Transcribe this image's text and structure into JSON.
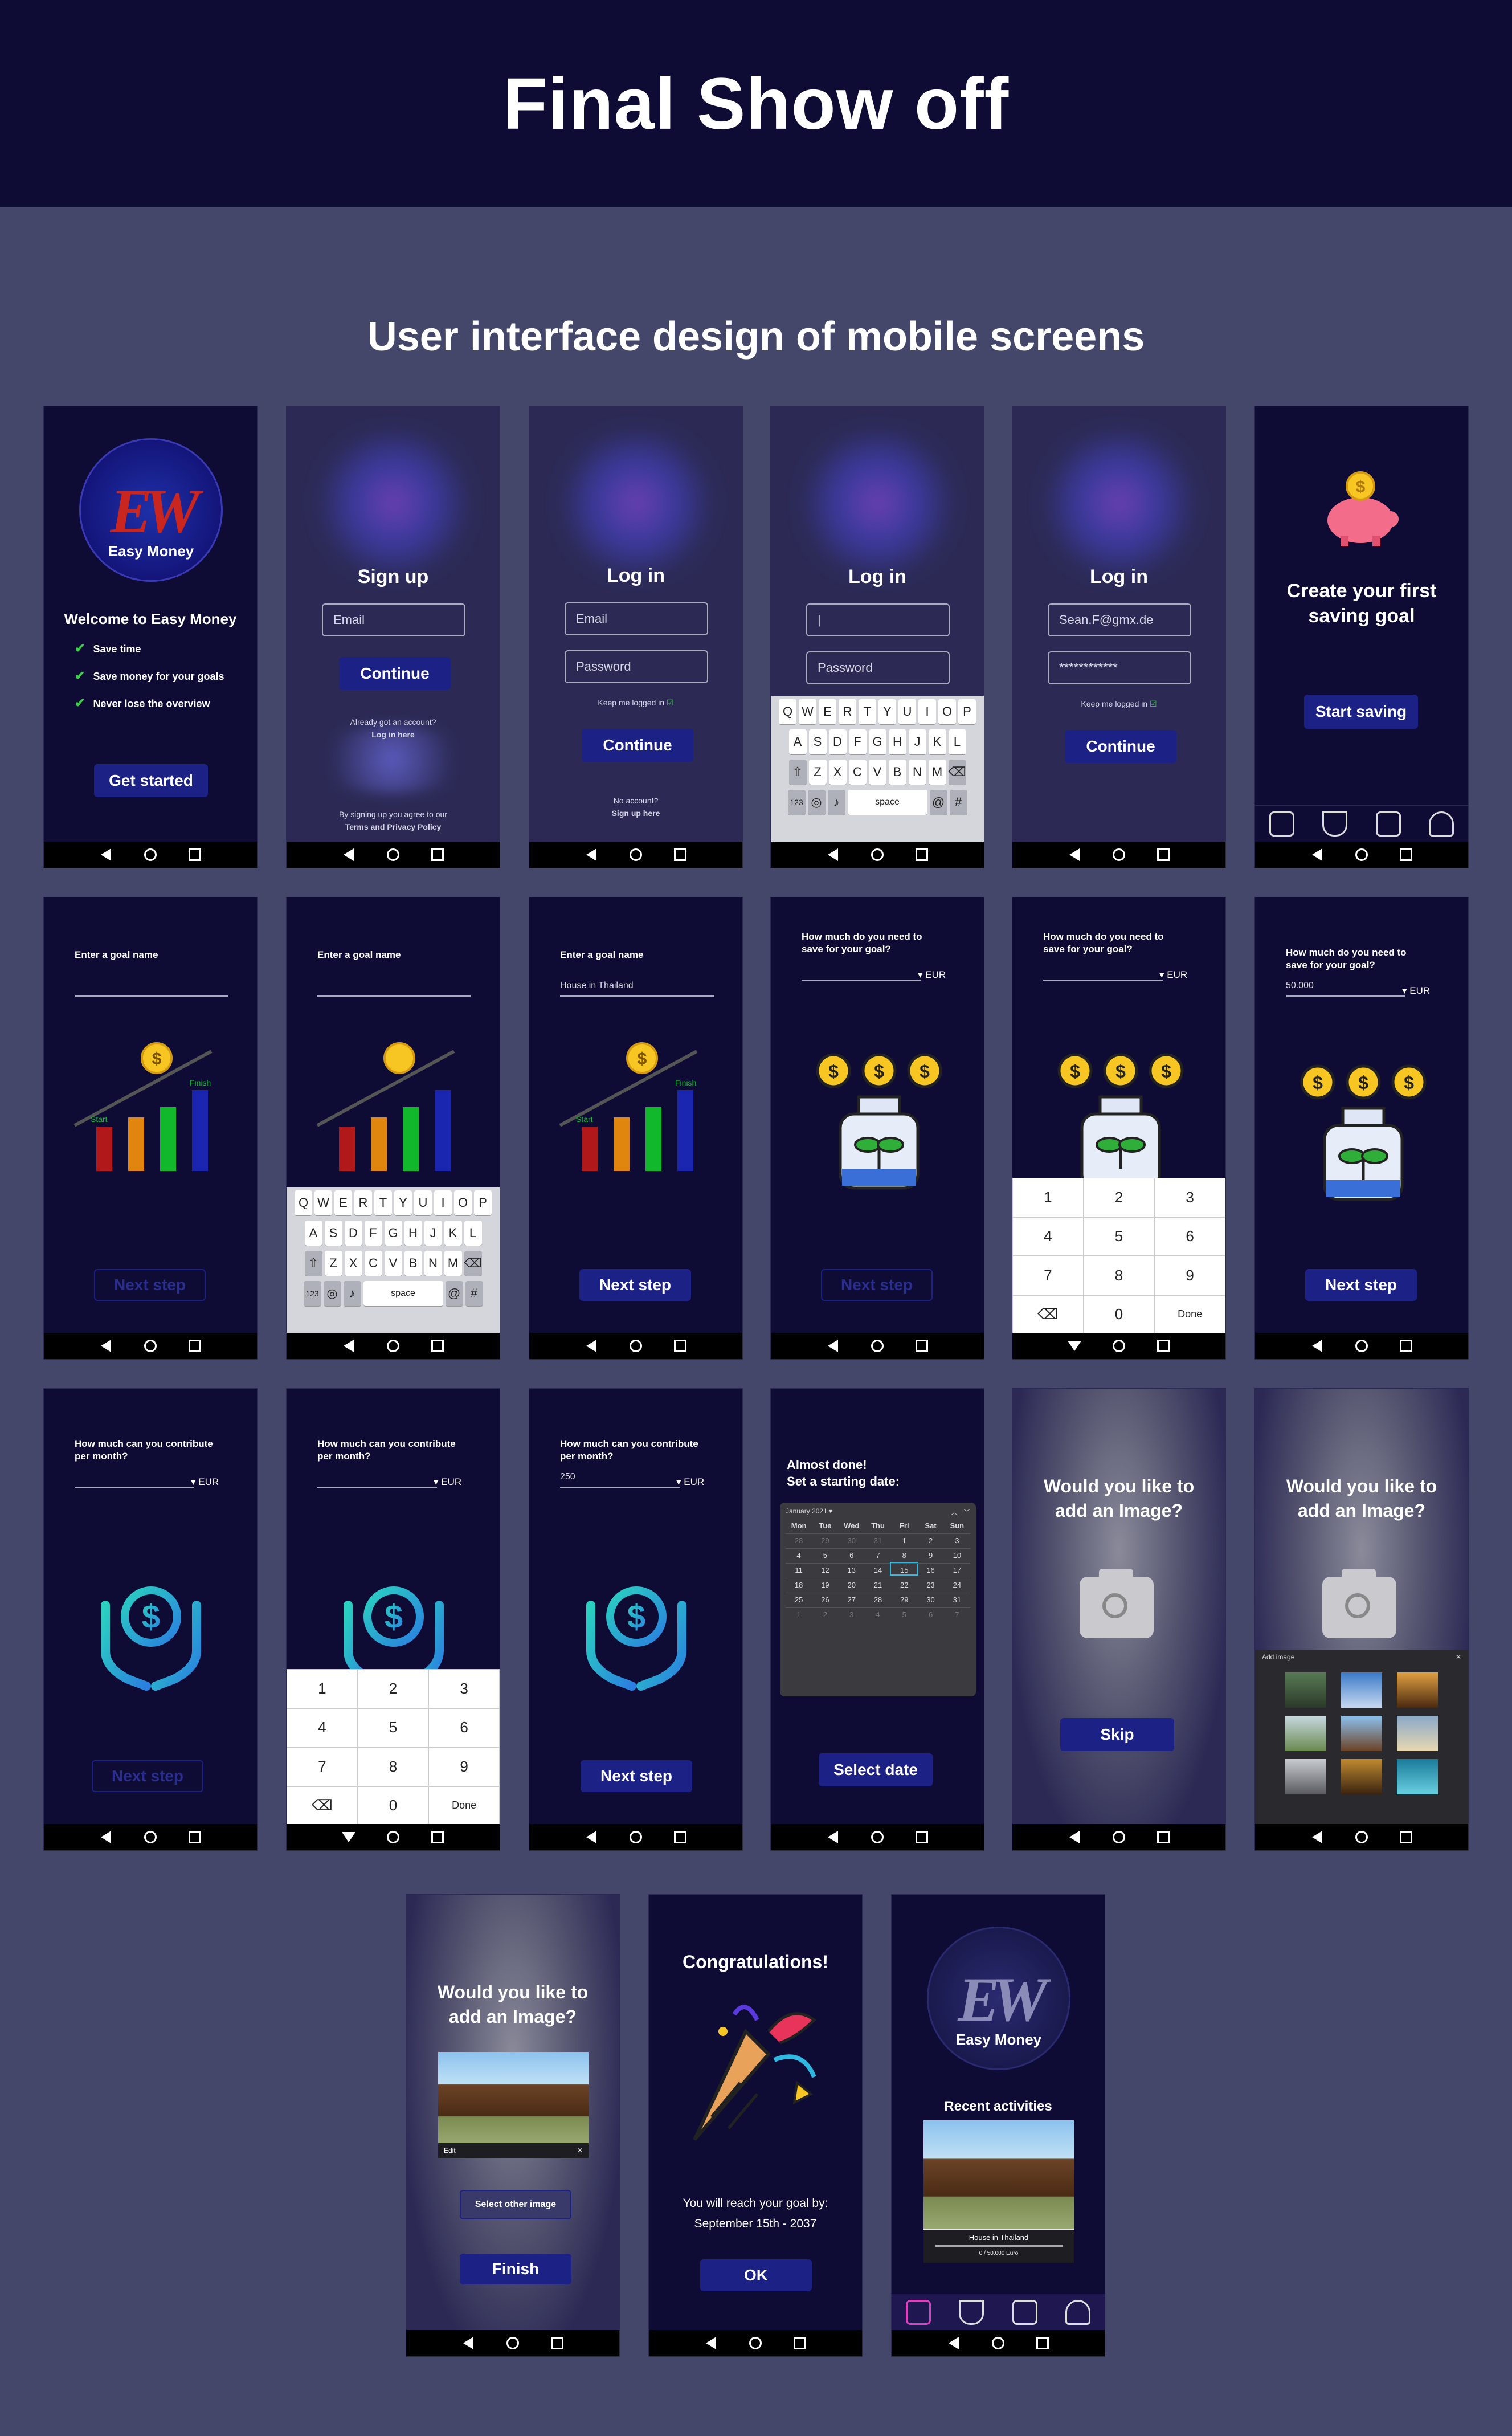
{
  "page_title": "Final Show off",
  "subtitle": "User interface design of mobile screens",
  "welcome": {
    "logo_text": "Easy Money",
    "headline": "Welcome to Easy Money",
    "features": [
      "Save time",
      "Save money for your goals",
      "Never lose the overview"
    ],
    "cta": "Get started"
  },
  "signup": {
    "title": "Sign up",
    "email_placeholder": "Email",
    "continue": "Continue",
    "already": "Already got an account?",
    "login_link": "Log in here",
    "terms1": "By signing up you agree to our",
    "terms2": "Terms and Privacy Policy"
  },
  "login": {
    "title": "Log in",
    "email_placeholder": "Email",
    "password_placeholder": "Password",
    "keep": "Keep me logged in",
    "continue": "Continue",
    "no_account": "No account?",
    "signup_link": "Sign up here",
    "email_value": "Sean.F@gmx.de",
    "password_value": "************",
    "cursor": "|"
  },
  "first_goal": {
    "title_l1": "Create your first",
    "title_l2": "saving goal",
    "cta": "Start saving"
  },
  "goal_name": {
    "label": "Enter a goal name",
    "value": "House in Thailand",
    "start": "Start",
    "finish": "Finish",
    "next": "Next step"
  },
  "amount": {
    "label_l1": "How much do you need to",
    "label_l2": "save for your goal?",
    "currency": "EUR",
    "value": "50.000",
    "next": "Next step"
  },
  "contrib": {
    "label_l1": "How much can you contribute",
    "label_l2": "per month?",
    "currency": "EUR",
    "value": "250",
    "next": "Next step"
  },
  "date": {
    "title_l1": "Almost done!",
    "title_l2": "Set a starting date:",
    "month": "January 2021",
    "weekdays": [
      "Mon",
      "Tue",
      "Wed",
      "Thu",
      "Fri",
      "Sat",
      "Sun"
    ],
    "rows": [
      [
        "28",
        "29",
        "30",
        "31",
        "1",
        "2",
        "3"
      ],
      [
        "4",
        "5",
        "6",
        "7",
        "8",
        "9",
        "10"
      ],
      [
        "11",
        "12",
        "13",
        "14",
        "15",
        "16",
        "17"
      ],
      [
        "18",
        "19",
        "20",
        "21",
        "22",
        "23",
        "24"
      ],
      [
        "25",
        "26",
        "27",
        "28",
        "29",
        "30",
        "31"
      ],
      [
        "1",
        "2",
        "3",
        "4",
        "5",
        "6",
        "7"
      ]
    ],
    "cta": "Select date"
  },
  "image": {
    "title_l1": "Would you like to",
    "title_l2": "add an Image?",
    "skip": "Skip",
    "add_image": "Add image",
    "edit": "Edit",
    "select_other": "Select other image",
    "finish": "Finish"
  },
  "congrats": {
    "title": "Congratulations!",
    "line1": "You will reach your goal by:",
    "line2": "September 15th - 2037",
    "ok": "OK"
  },
  "home": {
    "logo_text": "Easy Money",
    "recent": "Recent activities",
    "caption": "House in Thailand",
    "progress": "0 / 50.000 Euro"
  },
  "keyboard": {
    "row1": [
      "Q",
      "W",
      "E",
      "R",
      "T",
      "Y",
      "U",
      "I",
      "O",
      "P"
    ],
    "row2": [
      "A",
      "S",
      "D",
      "F",
      "G",
      "H",
      "J",
      "K",
      "L"
    ],
    "row3": [
      "Z",
      "X",
      "C",
      "V",
      "B",
      "N",
      "M"
    ],
    "num_key": "123",
    "space": "space",
    "at": "@",
    "hash": "#"
  },
  "numpad": {
    "keys": [
      "1",
      "2",
      "3",
      "4",
      "5",
      "6",
      "7",
      "8",
      "9",
      "⌫",
      "0",
      "Done"
    ]
  },
  "colors": {
    "bg": "#45476a",
    "screen": "#0e0b34",
    "button": "#1c2185",
    "check": "#3ecf4a"
  }
}
